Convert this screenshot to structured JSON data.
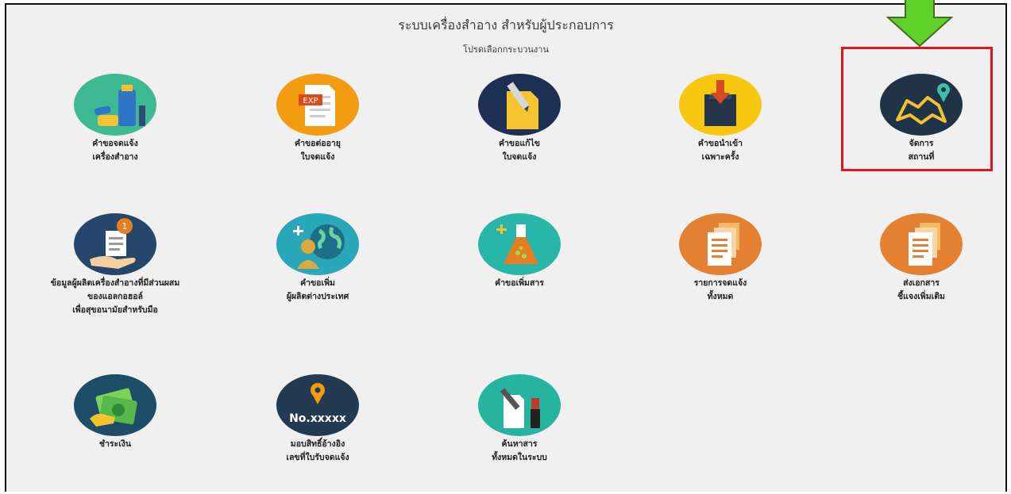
{
  "header": {
    "title": "ระบบเครื่องสำอาง สำหรับผู้ประกอบการ",
    "subtitle": "โปรดเลือกกระบวนงาน"
  },
  "menu": {
    "items": [
      {
        "lines": [
          "คำขอจดแจ้ง",
          "เครื่องสำอาง"
        ],
        "icon": "cosmetics-icon"
      },
      {
        "lines": [
          "คำขอต่ออายุ",
          "ใบจดแจ้ง"
        ],
        "icon": "exp-document-icon",
        "badge": "EXP"
      },
      {
        "lines": [
          "คำขอแก้ไข",
          "ใบจดแจ้ง"
        ],
        "icon": "edit-document-icon"
      },
      {
        "lines": [
          "คำขอนำเข้า",
          "เฉพาะครั้ง"
        ],
        "icon": "import-box-icon"
      },
      {
        "lines": [
          "จัดการ",
          "สถานที่"
        ],
        "icon": "map-location-icon"
      },
      {
        "lines": [
          "ข้อมูลผู้ผลิตเครื่องสำอางที่มีส่วนผสม",
          "ของแอลกอฮอล์",
          "เพื่อสุขอนามัยสำหรับมือ"
        ],
        "icon": "hand-document-icon",
        "badge": "1"
      },
      {
        "lines": [
          "คำขอเพิ่ม",
          "ผู้ผลิตต่างประเทศ"
        ],
        "icon": "add-foreign-manufacturer-icon"
      },
      {
        "lines": [
          "คำขอเพิ่มสาร"
        ],
        "icon": "add-substance-flask-icon"
      },
      {
        "lines": [
          "รายการจดแจ้ง",
          "ทั้งหมด"
        ],
        "icon": "documents-list-icon"
      },
      {
        "lines": [
          "ส่งเอกสาร",
          "ชี้แจงเพิ่มเติม"
        ],
        "icon": "documents-send-icon"
      },
      {
        "lines": [
          "ชำระเงิน"
        ],
        "icon": "payment-money-icon"
      },
      {
        "lines": [
          "มอบสิทธิ์อ้างอิง",
          "เลขที่ใบรับจดแจ้ง"
        ],
        "icon": "reference-number-icon",
        "badge": "No.xxxxx"
      },
      {
        "lines": [
          "ค้นหาสาร",
          "ทั้งหมดในระบบ"
        ],
        "icon": "search-substance-icon"
      }
    ]
  },
  "annotation": {
    "highlight_color": "#e0161e",
    "arrow_color": "#5fd12a"
  }
}
